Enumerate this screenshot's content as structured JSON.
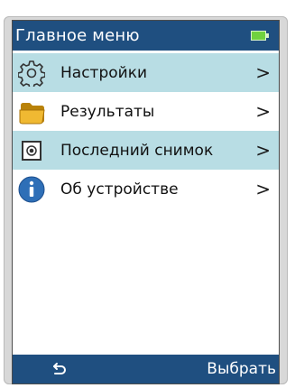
{
  "header": {
    "title": "Главное меню",
    "battery_icon": "battery-icon"
  },
  "menu": {
    "items": [
      {
        "label": "Настройки",
        "icon": "gear-icon",
        "highlighted": true
      },
      {
        "label": "Результаты",
        "icon": "folder-icon",
        "highlighted": false
      },
      {
        "label": "Последний снимок",
        "icon": "snapshot-icon",
        "highlighted": true
      },
      {
        "label": "Об устройстве",
        "icon": "info-icon",
        "highlighted": false
      }
    ],
    "chevron": ">"
  },
  "footer": {
    "back_icon": "back-arrow-icon",
    "select_label": "Выбрать"
  },
  "colors": {
    "header_background": "#1f4f80",
    "highlight_background": "#b8dde4",
    "battery": "#70d23f",
    "folder": "#d9a21c",
    "info": "#2e6fb7"
  }
}
